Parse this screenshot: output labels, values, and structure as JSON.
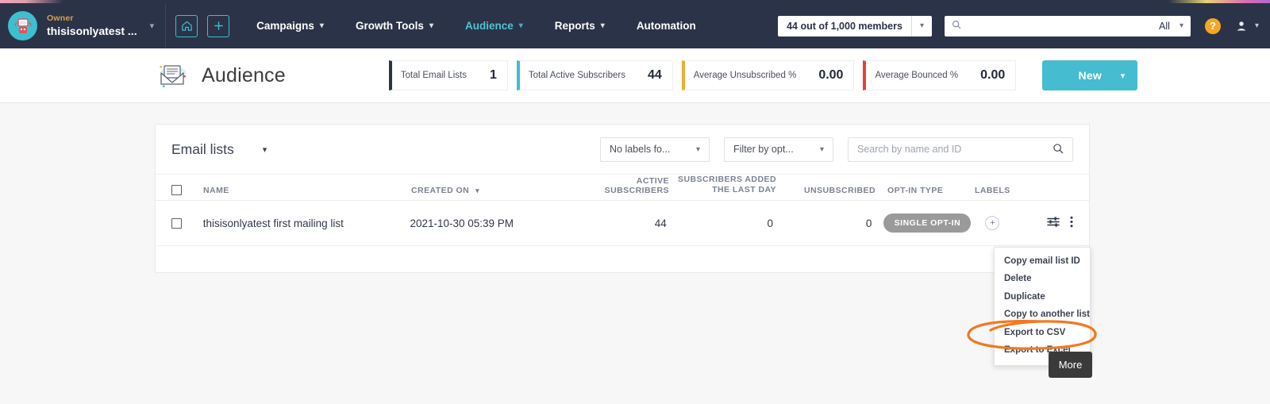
{
  "topnav": {
    "owner_label": "Owner",
    "owner_name": "thisisonlyatest ...",
    "home_icon": "home-icon",
    "add_icon": "plus-icon",
    "links": [
      {
        "label": "Campaigns",
        "caret": true,
        "active": false
      },
      {
        "label": "Growth Tools",
        "caret": true,
        "active": false
      },
      {
        "label": "Audience",
        "caret": true,
        "active": true
      },
      {
        "label": "Reports",
        "caret": true,
        "active": false
      },
      {
        "label": "Automation",
        "caret": false,
        "active": false
      }
    ],
    "members": "44 out of 1,000 members",
    "search_placeholder": "",
    "search_value": "",
    "search_scope": "All",
    "help_label": "?",
    "accent": "#3dbfcf",
    "bg": "#2b3348"
  },
  "header": {
    "icon": "envelope-icon",
    "title": "Audience",
    "stats": [
      {
        "label": "Total Email Lists",
        "value": "1",
        "color": "#2b3348"
      },
      {
        "label": "Total Active Subscribers",
        "value": "44",
        "color": "#3dbfcf"
      },
      {
        "label": "Average Unsubscribed %",
        "value": "0.00",
        "color": "#f0ad2e"
      },
      {
        "label": "Average Bounced %",
        "value": "0.00",
        "color": "#e8403a"
      }
    ],
    "new_button": {
      "label": "New",
      "caret": "chevron-down-icon",
      "color": "#45bcd0"
    }
  },
  "card": {
    "title": "Email lists",
    "title_caret": "chevron-down-icon",
    "filters": {
      "labels_select": "No labels fo...",
      "optin_select": "Filter by opt...",
      "search_placeholder": "Search by name and ID",
      "search_value": ""
    },
    "columns": [
      "NAME",
      "CREATED ON",
      "ACTIVE SUBSCRIBERS",
      "SUBSCRIBERS ADDED THE LAST DAY",
      "UNSUBSCRIBED",
      "OPT-IN TYPE",
      "LABELS"
    ],
    "column_add_line1": "SUBSCRIBERS ADDED",
    "column_add_line2": "THE LAST DAY",
    "rows": [
      {
        "name": "thisisonlyatest first mailing list",
        "created_on": "2021-10-30 05:39 PM",
        "active_subscribers": "44",
        "subscribers_added_last_day": "0",
        "unsubscribed": "0",
        "optin_type": "SINGLE OPT-IN",
        "labels_add": "+",
        "settings_icon": "sliders-icon",
        "more_icon": "kebab-menu-icon"
      }
    ]
  },
  "context_menu": {
    "items": [
      "Copy email list ID",
      "Delete",
      "Duplicate",
      "Copy to another list",
      "Export to CSV",
      "Export to Excel"
    ],
    "highlighted": "Export to Excel",
    "highlight_color": "#f4781f"
  },
  "tooltip": {
    "text": "More"
  }
}
